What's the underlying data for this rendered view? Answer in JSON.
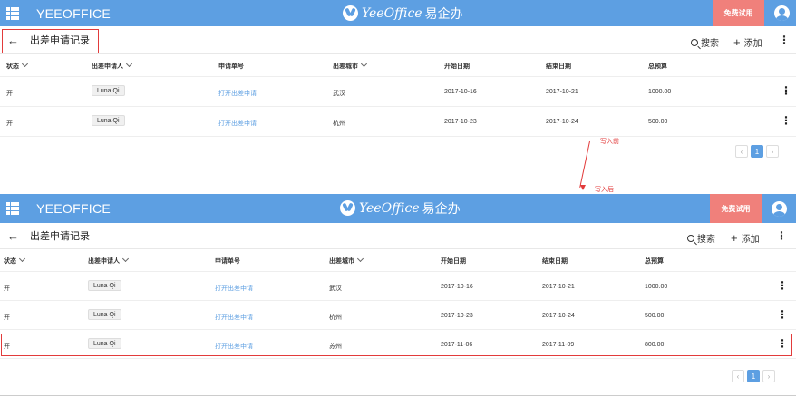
{
  "app": {
    "title": "YEEOFFICE",
    "logo_latin": "YeeOffice",
    "logo_cn": "易企办",
    "trial_label": "免费试用"
  },
  "page": {
    "title": "出差申请记录",
    "search_label": "搜索",
    "add_label": "添加",
    "back": "←",
    "more": "⋮"
  },
  "columns": {
    "status": "状态",
    "applicant": "出差申请人",
    "form": "申请单号",
    "city": "出差城市",
    "start": "开始日期",
    "end": "结束日期",
    "budget": "总预算"
  },
  "before": {
    "rows": [
      {
        "status": "开",
        "applicant": "Luna Qi",
        "form": "打开出差申请",
        "city": "武汉",
        "start": "2017-10-16",
        "end": "2017-10-21",
        "budget": "1000.00"
      },
      {
        "status": "开",
        "applicant": "Luna Qi",
        "form": "打开出差申请",
        "city": "杭州",
        "start": "2017-10-23",
        "end": "2017-10-24",
        "budget": "500.00"
      }
    ]
  },
  "after": {
    "rows": [
      {
        "status": "开",
        "applicant": "Luna Qi",
        "form": "打开出差申请",
        "city": "武汉",
        "start": "2017-10-16",
        "end": "2017-10-21",
        "budget": "1000.00"
      },
      {
        "status": "开",
        "applicant": "Luna Qi",
        "form": "打开出差申请",
        "city": "杭州",
        "start": "2017-10-23",
        "end": "2017-10-24",
        "budget": "500.00"
      },
      {
        "status": "开",
        "applicant": "Luna Qi",
        "form": "打开出差申请",
        "city": "苏州",
        "start": "2017-11-06",
        "end": "2017-11-09",
        "budget": "800.00"
      }
    ]
  },
  "pager": {
    "prev": "‹",
    "current": "1",
    "next": "›"
  },
  "annotations": {
    "before_label": "写入前",
    "after_label": "写入后"
  },
  "colors": {
    "brand": "#5d9fe2",
    "trial": "#f0807b",
    "highlight": "#e23b3b"
  }
}
